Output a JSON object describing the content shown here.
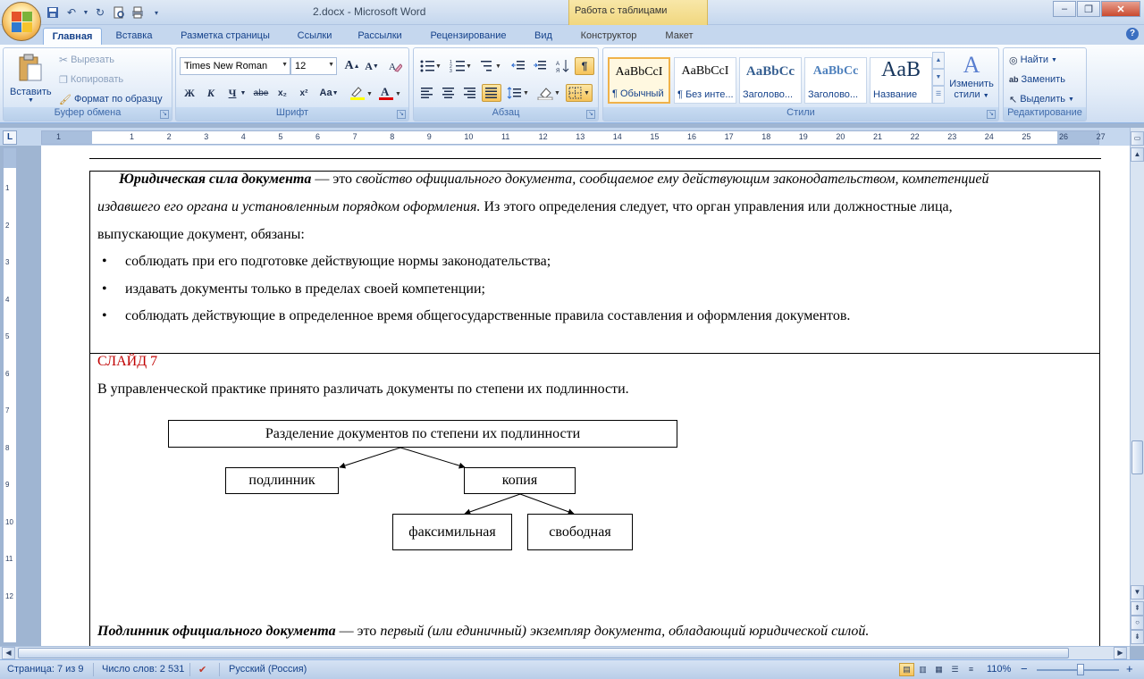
{
  "window": {
    "title": "2.docx - Microsoft Word",
    "context_title": "Работа с таблицами",
    "ctrl_minimize": "‒",
    "ctrl_maximize": "❐",
    "ctrl_close": "✕"
  },
  "tabs": [
    "Главная",
    "Вставка",
    "Разметка страницы",
    "Ссылки",
    "Рассылки",
    "Рецензирование",
    "Вид",
    "Конструктор",
    "Макет"
  ],
  "active_tab": "Главная",
  "ribbon": {
    "clipboard": {
      "paste_label": "Вставить",
      "cut_label": "Вырезать",
      "copy_label": "Копировать",
      "format_painter_label": "Формат по образцу",
      "group_label": "Буфер обмена"
    },
    "font": {
      "font_name": "Times New Roman",
      "font_size": "12",
      "group_label": "Шрифт",
      "bold": "Ж",
      "italic": "К",
      "underline": "Ч",
      "strike": "abe",
      "subscript": "x₂",
      "superscript": "x²",
      "change_case": "Aa",
      "grow": "A",
      "shrink": "A",
      "color_a": "A"
    },
    "paragraph": {
      "group_label": "Абзац"
    },
    "styles": {
      "group_label": "Стили",
      "items": [
        {
          "preview": "AaBbCcI",
          "name": "¶ Обычный"
        },
        {
          "preview": "AaBbCcI",
          "name": "¶ Без инте..."
        },
        {
          "preview": "AaBbCc",
          "name": "Заголово..."
        },
        {
          "preview": "AaBbCc",
          "name": "Заголово..."
        },
        {
          "preview": "AaB",
          "name": "Название"
        }
      ],
      "change_styles_label_1": "Изменить",
      "change_styles_label_2": "стили"
    },
    "editing": {
      "find_label": "Найти",
      "replace_label": "Заменить",
      "select_label": "Выделить",
      "group_label": "Редактирование"
    }
  },
  "ruler": {
    "tab_selector": "L",
    "h_numbers": [
      "1",
      "1",
      "2",
      "3",
      "4",
      "5",
      "6",
      "7",
      "8",
      "9",
      "10",
      "11",
      "12",
      "13",
      "14",
      "15",
      "16",
      "17",
      "18",
      "19",
      "20",
      "21",
      "22",
      "23",
      "24",
      "25",
      "26",
      "27"
    ],
    "v_numbers": [
      "1",
      "2",
      "3",
      "4",
      "5",
      "6",
      "7",
      "8",
      "9",
      "10",
      "11",
      "12"
    ]
  },
  "document": {
    "p1_term": "Юридическая сила документа",
    "p1_dash": " — это ",
    "p1_def_line1": "свойство официального документа, сообщаемое ему действующим законодательством, компетенцией",
    "p1_def_line2a": "издавшего его органа и установленным порядком оформления.",
    "p1_line2b": " Из этого определения следует, что орган управления или должностные лица,",
    "p1_line3": "выпускающие документ, обязаны:",
    "bullet_char": "•",
    "bullets": [
      "соблюдать при его подготовке действующие нормы законодательства;",
      "издавать документы только в пределах своей компетенции;",
      "соблюдать действующие в определенное время общегосударственные правила составления и оформления документов."
    ],
    "slide_label": "СЛАЙД 7",
    "slide_color": "#c00000",
    "intro": "В управленческой практике принято различать документы по степени их подлинности.",
    "diagram": {
      "root": "Разделение документов по степени их подлинности",
      "left": "подлинник",
      "right": "копия",
      "right_child_1": "факсимильная",
      "right_child_2": "свободная"
    },
    "last_term": "Подлинник официального документа",
    "last_dash": " — это ",
    "last_def": "первый (или единичный) экземпляр документа, обладающий юридической силой."
  },
  "status": {
    "page": "Страница: 7 из 9",
    "words": "Число слов: 2 531",
    "language": "Русский (Россия)",
    "zoom": "110%",
    "zoom_minus": "−",
    "zoom_plus": "+"
  }
}
